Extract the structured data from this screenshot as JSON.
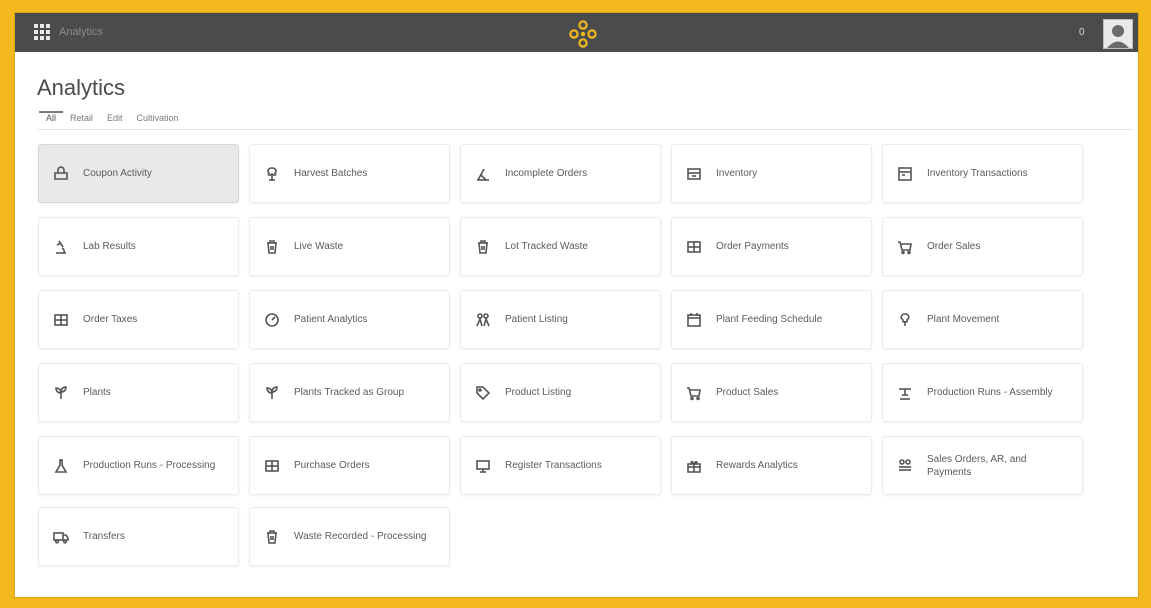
{
  "topbar": {
    "app_name": "Analytics",
    "notification_count": "0"
  },
  "page": {
    "title": "Analytics"
  },
  "tabs": [
    {
      "label": "All"
    },
    {
      "label": "Retail"
    },
    {
      "label": "Edit"
    },
    {
      "label": "Cultivation"
    }
  ],
  "reports": [
    {
      "label": "Coupon Activity",
      "icon": "coupon-icon"
    },
    {
      "label": "Harvest Batches",
      "icon": "harvest-icon"
    },
    {
      "label": "Incomplete Orders",
      "icon": "incomplete-orders-icon"
    },
    {
      "label": "Inventory",
      "icon": "inventory-icon"
    },
    {
      "label": "Inventory Transactions",
      "icon": "inventory-transactions-icon"
    },
    {
      "label": "Lab Results",
      "icon": "microscope-icon"
    },
    {
      "label": "Live Waste",
      "icon": "trash-icon"
    },
    {
      "label": "Lot Tracked Waste",
      "icon": "trash-icon"
    },
    {
      "label": "Order Payments",
      "icon": "payments-icon"
    },
    {
      "label": "Order Sales",
      "icon": "cart-icon"
    },
    {
      "label": "Order Taxes",
      "icon": "taxes-icon"
    },
    {
      "label": "Patient Analytics",
      "icon": "gauge-icon"
    },
    {
      "label": "Patient Listing",
      "icon": "people-icon"
    },
    {
      "label": "Plant Feeding Schedule",
      "icon": "calendar-icon"
    },
    {
      "label": "Plant Movement",
      "icon": "plant-icon"
    },
    {
      "label": "Plants",
      "icon": "plant-icon"
    },
    {
      "label": "Plants Tracked as Group",
      "icon": "plant-icon"
    },
    {
      "label": "Product Listing",
      "icon": "tag-icon"
    },
    {
      "label": "Product Sales",
      "icon": "cart-icon"
    },
    {
      "label": "Production Runs - Assembly",
      "icon": "assembly-icon"
    },
    {
      "label": "Production Runs - Processing",
      "icon": "flask-icon"
    },
    {
      "label": "Purchase Orders",
      "icon": "purchase-orders-icon"
    },
    {
      "label": "Register Transactions",
      "icon": "monitor-icon"
    },
    {
      "label": "Rewards Analytics",
      "icon": "gift-icon"
    },
    {
      "label": "Sales Orders, AR, and Payments",
      "icon": "sales-orders-icon"
    },
    {
      "label": "Transfers",
      "icon": "truck-icon"
    },
    {
      "label": "Waste Recorded - Processing",
      "icon": "trash-icon"
    }
  ],
  "theme": {
    "frame_color": "#f2b81c",
    "topbar_color": "#4a4b4d",
    "logo_color": "#f2b81c"
  }
}
